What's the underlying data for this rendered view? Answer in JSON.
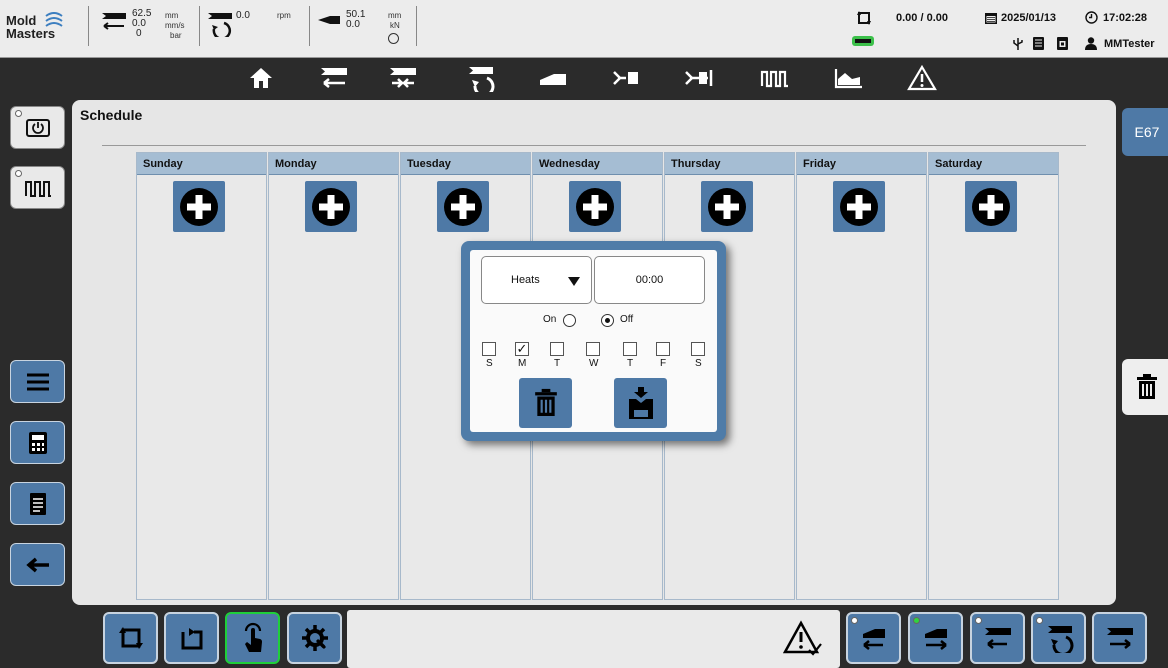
{
  "brand": {
    "line1": "Mold",
    "line2": "Masters"
  },
  "status": {
    "injection": {
      "v1": "62.5",
      "u1": "mm",
      "v2": "0.0",
      "u2": "mm/s",
      "v3": "0",
      "u3": "bar"
    },
    "screw": {
      "v1": "0.0",
      "u1": "rpm"
    },
    "clamp": {
      "v1": "50.1",
      "u1": "mm",
      "v2": "0.0",
      "u2": "kN"
    },
    "ratio": "0.00 / 0.00",
    "date": "2025/01/13",
    "time": "17:02:28",
    "user": "MMTester"
  },
  "nav": {
    "icons": [
      "home-icon",
      "injection-icon",
      "injection-hold-icon",
      "screw-rotation-icon",
      "clamp-icon",
      "ejector-icon",
      "core-pull-icon",
      "heats-icon",
      "graph-icon",
      "alarm-icon"
    ]
  },
  "page": {
    "title": "Schedule"
  },
  "days": [
    {
      "label": "Sunday"
    },
    {
      "label": "Monday"
    },
    {
      "label": "Tuesday"
    },
    {
      "label": "Wednesday"
    },
    {
      "label": "Thursday"
    },
    {
      "label": "Friday"
    },
    {
      "label": "Saturday"
    }
  ],
  "side": {
    "error_code": "E67"
  },
  "dialog": {
    "select_value": "Heats",
    "time_value": "00:00",
    "on_label": "On",
    "off_label": "Off",
    "selected_state": "Off",
    "weekdays": [
      {
        "label": "S",
        "checked": false
      },
      {
        "label": "M",
        "checked": true
      },
      {
        "label": "T",
        "checked": false
      },
      {
        "label": "W",
        "checked": false
      },
      {
        "label": "T",
        "checked": false
      },
      {
        "label": "F",
        "checked": false
      },
      {
        "label": "S",
        "checked": false
      }
    ],
    "checkmark": "✓"
  },
  "colors": {
    "accent": "#4e79a6",
    "header": "#a5bdd3",
    "active": "#1fcf3a"
  }
}
